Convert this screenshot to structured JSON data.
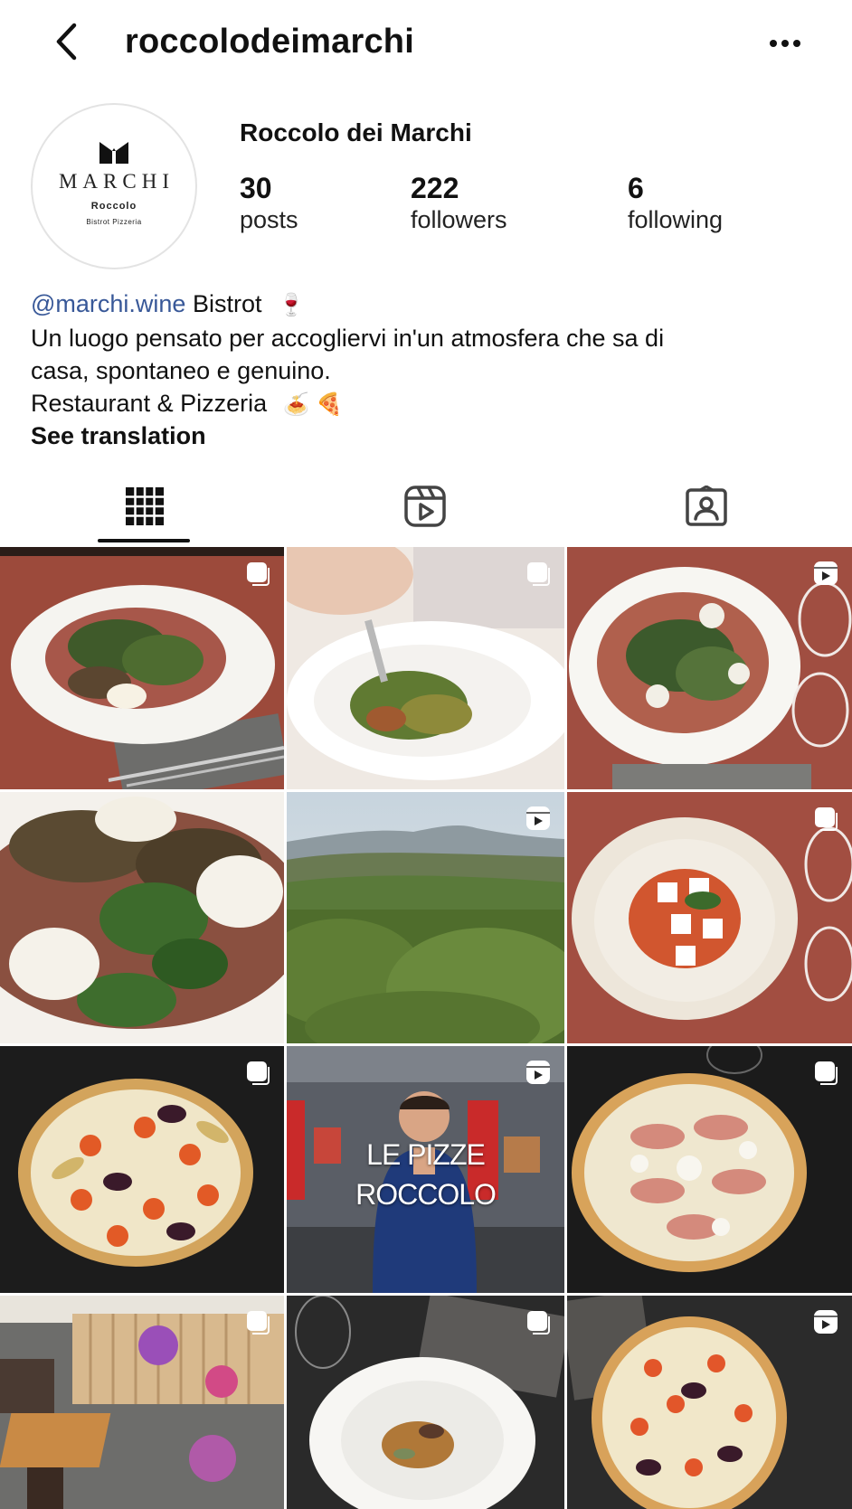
{
  "header": {
    "username": "roccolodeimarchi"
  },
  "profile": {
    "display_name": "Roccolo dei Marchi",
    "logo": {
      "brand": "MARCHI",
      "sub": "Roccolo",
      "sub2": "Bistrot Pizzeria"
    },
    "stats": {
      "posts": {
        "value": "30",
        "label": "posts"
      },
      "followers": {
        "value": "222",
        "label": "followers"
      },
      "following": {
        "value": "6",
        "label": "following"
      }
    }
  },
  "bio": {
    "mention": "@marchi.wine",
    "line1_rest": "Bistrot",
    "line1_emoji": "🍷",
    "line2": "Un luogo pensato per accogliervi in'un atmosfera che sa di",
    "line3": "casa, spontaneo e genuino.",
    "line4": "Restaurant & Pizzeria",
    "line4_emoji": "🍝 🍕",
    "see_translation": "See translation"
  },
  "tabs": [
    {
      "name": "grid-icon",
      "active": true
    },
    {
      "name": "reels-icon",
      "active": false
    },
    {
      "name": "tagged-icon",
      "active": false
    }
  ],
  "posts": [
    {
      "type": "carousel",
      "subject": "beef carpaccio with greens"
    },
    {
      "type": "carousel",
      "subject": "gnocchi with vegetables"
    },
    {
      "type": "reel",
      "subject": "beef carpaccio with burrata"
    },
    {
      "type": "none",
      "subject": "carpaccio close-up"
    },
    {
      "type": "reel",
      "subject": "vineyard hills"
    },
    {
      "type": "carousel",
      "subject": "tomato and feta salad"
    },
    {
      "type": "carousel",
      "subject": "pizza with tomatoes and zucchini"
    },
    {
      "type": "reel",
      "subject": "chef in restaurant",
      "overlay_line1": "LE PIZZE",
      "overlay_line2": "ROCCOLO"
    },
    {
      "type": "carousel",
      "subject": "pizza with prosciutto"
    },
    {
      "type": "carousel",
      "subject": "outdoor terrace"
    },
    {
      "type": "carousel",
      "subject": "pasta dish"
    },
    {
      "type": "reel",
      "subject": "pizza with vegetables"
    }
  ],
  "colors": {
    "link": "#385898",
    "text": "#111111",
    "divider": "#ffffff"
  }
}
